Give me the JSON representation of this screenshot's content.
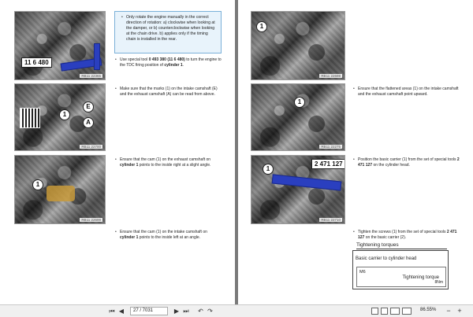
{
  "left_page": {
    "photo1": {
      "tool_label": "11 6 480",
      "caption": "RB11 22365"
    },
    "note_items": [
      "Only rotate the engine manually in the correct direction of rotation: a) clockwise when looking at the damper, or b) counterclockwise when looking at the chain drive. b) applies only if the timing chain is installed in the rear."
    ],
    "step1": {
      "pre": "Use special tool ",
      "tool": "0 493 380 (11 6 480)",
      "mid": " to turn the engine to the TDC firing position of ",
      "cyl": "cylinder 1",
      "post": "."
    },
    "photo2": {
      "label_e": "E",
      "label_a": "A",
      "label_1": "1",
      "caption": "RB11 22700"
    },
    "step2": "Make sure that the marks (1) on the intake camshaft (E) and the exhaust camshaft (A) can be read from above.",
    "photo3": {
      "label_1": "1",
      "caption": "RB11 22699"
    },
    "step3": {
      "pre": "Ensure that the cam (1) on the exhaust camshaft on ",
      "cyl": "cylinder 1",
      "post": " points to the inside right at a slight angle."
    },
    "step4": {
      "pre": "Ensure that the cam (1) on the intake camshaft on ",
      "cyl": "cylinder 1",
      "post": " points to the inside left at an angle."
    }
  },
  "right_page": {
    "photo1": {
      "label_1": "1",
      "caption": "RB11 22698"
    },
    "step1": "Ensure that the flattened areas (1) on the intake camshaft and the exhaust camshaft point upward.",
    "photo2": {
      "label_1": "1",
      "caption": "RB11 22275"
    },
    "step2": {
      "pre": "Position the basic carrier (1) from the set of special tools ",
      "tool": "2 471 127",
      "post": " on the cylinder head."
    },
    "photo3": {
      "tool_label": "2 471 127",
      "label_1": "1",
      "caption": "RB11 22710"
    },
    "step3": {
      "pre": "Tighten the screws (1) from the set of special tools ",
      "tool": "2 471 127",
      "post": " on the basic carrier (2)."
    },
    "torque": {
      "title": "Tightening torques",
      "heading": "Basic carrier to cylinder head",
      "thread": "M6",
      "label": "Tightening torque",
      "unit": "8Nm"
    }
  },
  "toolbar": {
    "page_field": "27 / 7031",
    "zoom": "86.55%"
  }
}
